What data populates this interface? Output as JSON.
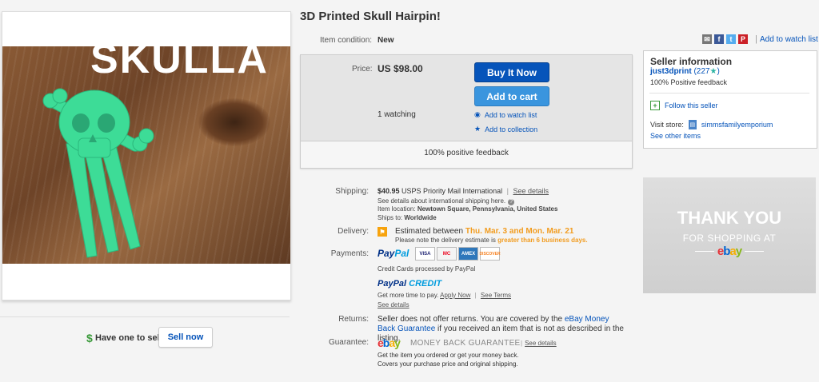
{
  "item": {
    "title": "3D Printed Skull Hairpin!",
    "condition_label": "Item condition:",
    "condition_value": "New",
    "image_overlay_text": "SKULLA"
  },
  "share": {
    "icons": [
      "email-icon",
      "facebook-icon",
      "twitter-icon",
      "pinterest-icon"
    ],
    "watch_link": "Add to watch list"
  },
  "buy": {
    "price_label": "Price:",
    "price": "US $98.00",
    "buy_now": "Buy It Now",
    "add_to_cart": "Add to cart",
    "watching": "1 watching",
    "add_watch": "Add to watch list",
    "add_collection": "Add to collection",
    "positive_feedback": "100% positive feedback"
  },
  "shipping": {
    "label": "Shipping:",
    "cost": "$40.95",
    "method": "USPS Priority Mail International",
    "see_details": "See details",
    "intl_note": "See details about international shipping here.",
    "location_label": "Item location:",
    "location": "Newtown Square, Pennsylvania, United States",
    "ships_to_label": "Ships to:",
    "ships_to": "Worldwide"
  },
  "delivery": {
    "label": "Delivery:",
    "estimated_prefix": "Estimated between",
    "range": "Thu. Mar. 3 and Mon. Mar. 21",
    "note_prefix": "Please note the delivery estimate is",
    "note_highlight": "greater than 6 business days."
  },
  "payments": {
    "label": "Payments:",
    "paypal_a": "Pay",
    "paypal_b": "Pal",
    "cards": [
      "VISA",
      "MC",
      "AMEX",
      "DISCOVER"
    ],
    "cc_note": "Credit Cards processed by PayPal",
    "credit_a": "PayPal",
    "credit_b": "CREDIT",
    "more_time": "Get more time to pay.",
    "apply_now": "Apply Now",
    "see_terms": "See Terms",
    "see_details": "See details"
  },
  "returns": {
    "label": "Returns:",
    "text_a": "Seller does not offer returns. You are covered by the ",
    "link": "eBay Money Back Guarantee",
    "text_b": " if you received an item that is not as described in the listing."
  },
  "guarantee": {
    "label": "Guarantee:",
    "logo": [
      "e",
      "b",
      "a",
      "y"
    ],
    "title": "MONEY BACK GUARANTEE",
    "see_details": "See details",
    "line1": "Get the item you ordered or get your money back.",
    "line2": "Covers your purchase price and original shipping."
  },
  "seller": {
    "title": "Seller information",
    "name": "just3dprint",
    "score": "(227",
    "score_end": ")",
    "feedback": "100% Positive feedback",
    "follow": "Follow this seller",
    "visit_store": "Visit store:",
    "store_name": "simmsfamilyemporium",
    "other_items": "See other items"
  },
  "sell": {
    "question": "Have one to sell?",
    "button": "Sell now"
  },
  "ad": {
    "line1": "THANK YOU",
    "line2": "FOR SHOPPING AT",
    "logo": [
      "e",
      "b",
      "a",
      "y"
    ]
  },
  "colors": {
    "ebay_logo": [
      "#e53238",
      "#0064d2",
      "#f5af02",
      "#86b817"
    ],
    "primary_blue": "#0654ba",
    "accent_orange": "#f29c1f",
    "skull_green": "#3ddc97"
  }
}
